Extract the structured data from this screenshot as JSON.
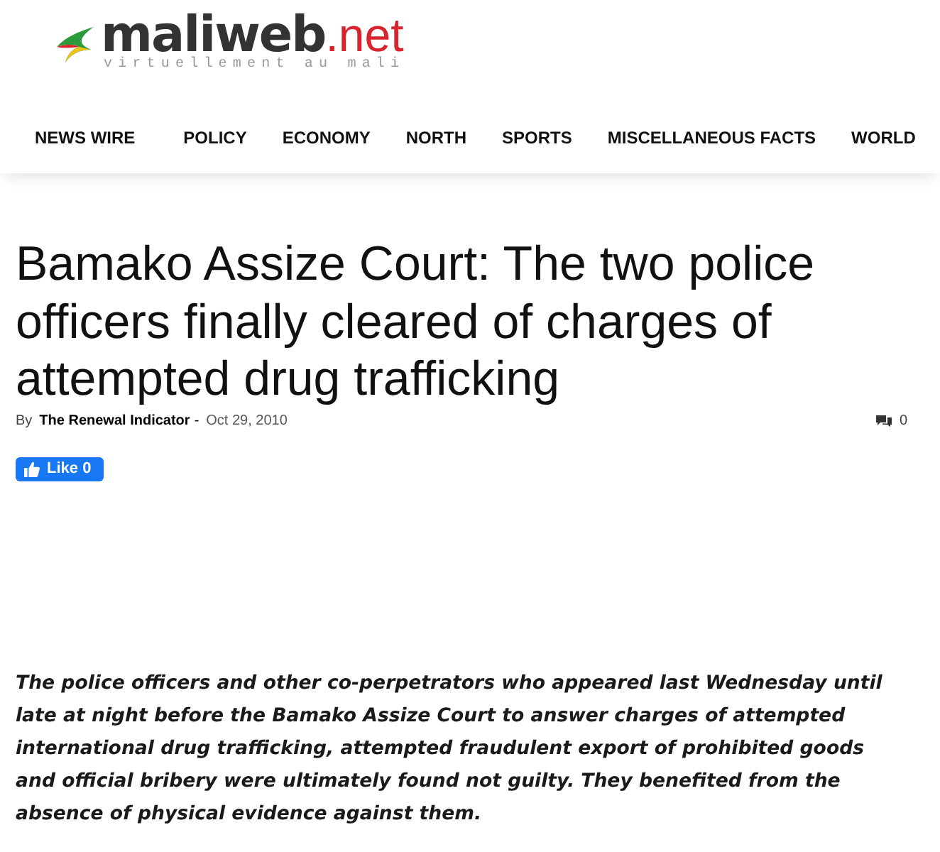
{
  "header": {
    "logo": {
      "name": "maliweb",
      "suffix": ".net",
      "tagline": "virtuellement au mali"
    }
  },
  "nav": {
    "items": [
      "NEWS WIRE",
      "POLICY",
      "ECONOMY",
      "NORTH",
      "SPORTS",
      "MISCELLANEOUS FACTS",
      "WORLD"
    ]
  },
  "article": {
    "title": "Bamako Assize Court: The two police officers finally cleared of charges of attempted drug trafficking",
    "byline": {
      "prefix": "By",
      "author": "The Renewal Indicator",
      "separator": "-",
      "date": "Oct 29, 2010",
      "comments": "0"
    },
    "like_button": {
      "label": "Like",
      "count": "0"
    },
    "lead": "The police officers and other co-perpetrators who appeared last Wednesday until late at night before the Bamako Assize Court to answer charges of attempted international drug trafficking, attempted fraudulent export of prohibited goods and official bribery were ultimately found not guilty. They benefited from the absence of physical evidence against them."
  }
}
